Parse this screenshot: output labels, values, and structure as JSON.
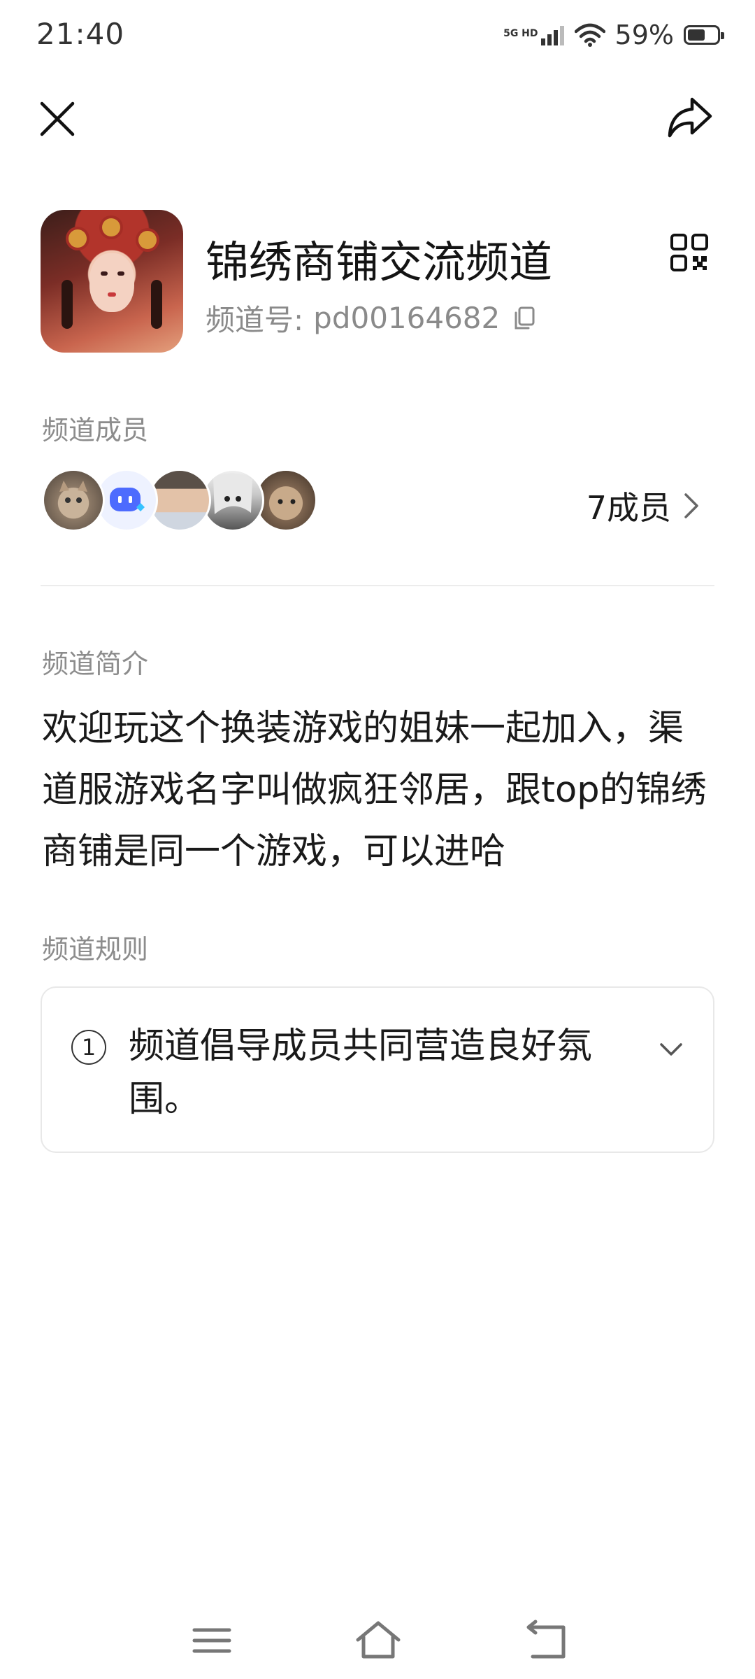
{
  "status_bar": {
    "time": "21:40",
    "network_top": "5G HD",
    "battery_percent": "59%",
    "battery_level": 0.59
  },
  "channel": {
    "title": "锦绣商铺交流频道",
    "id_label": "频道号:",
    "id_value": "pd00164682"
  },
  "members": {
    "section_label": "频道成员",
    "count_label": "7成员",
    "avatars": [
      "cat-avatar",
      "bot-avatar",
      "man-avatar",
      "anime-girl-avatar",
      "hamster-avatar"
    ]
  },
  "intro": {
    "section_label": "频道简介",
    "text": "欢迎玩这个换装游戏的姐妹一起加入，渠道服游戏名字叫做疯狂邻居，跟top的锦绣商铺是同一个游戏，可以进哈"
  },
  "rules": {
    "section_label": "频道规则",
    "items": [
      {
        "number": "1",
        "text": "频道倡导成员共同营造良好氛围。"
      }
    ]
  },
  "colors": {
    "text_primary": "#1a1a1a",
    "text_secondary": "#8c8c8c",
    "divider": "#ececec"
  }
}
